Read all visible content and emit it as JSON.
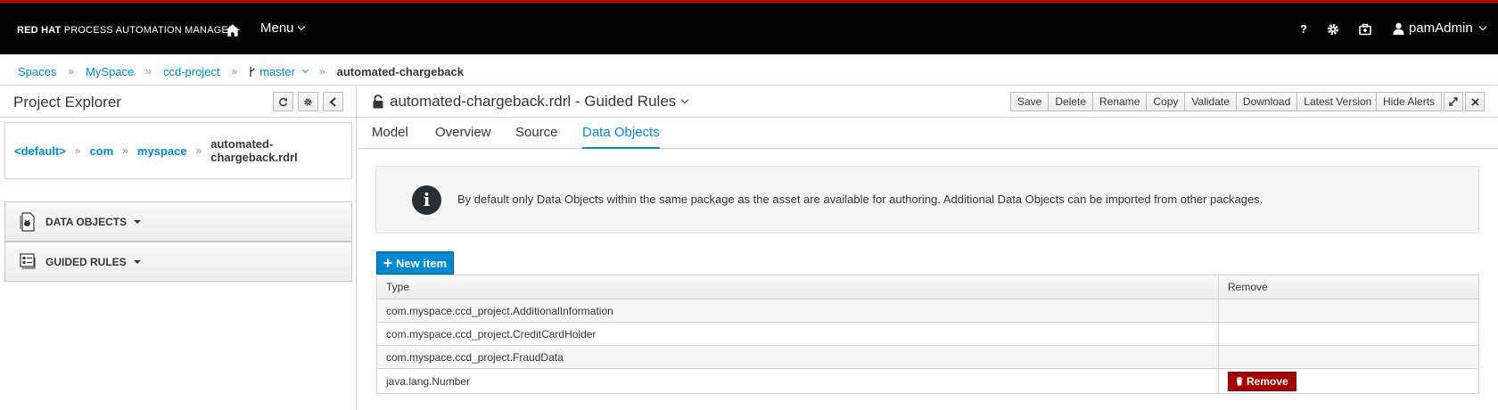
{
  "header": {
    "brand_bold": "RED HAT",
    "brand_rest": " PROCESS AUTOMATION MANAGER",
    "menu_label": "Menu",
    "help_label": "?",
    "user_name": "pamAdmin"
  },
  "breadcrumb": {
    "items": [
      "Spaces",
      "MySpace",
      "ccd-project"
    ],
    "branch": "master",
    "current": "automated-chargeback"
  },
  "project_explorer": {
    "title": "Project Explorer",
    "package_path": [
      "<default>",
      "com",
      "myspace"
    ],
    "file": "automated-chargeback.rdrl",
    "sections": [
      "DATA OBJECTS",
      "GUIDED RULES"
    ]
  },
  "editor": {
    "title": "automated-chargeback.rdrl - Guided Rules",
    "toolbar": [
      "Save",
      "Delete",
      "Rename",
      "Copy",
      "Validate",
      "Download"
    ],
    "version_label": "Latest Version",
    "hide_alerts": "Hide Alerts",
    "tabs": [
      "Model",
      "Overview",
      "Source",
      "Data Objects"
    ],
    "active_tab": "Data Objects",
    "info_text": "By default only Data Objects within the same package as the asset are available for authoring. Additional Data Objects can be imported from other packages.",
    "new_item_label": "New item",
    "table": {
      "headers": [
        "Type",
        "Remove"
      ],
      "rows": [
        "com.myspace.ccd_project.AdditionalInformation",
        "com.myspace.ccd_project.CreditCardHolder",
        "com.myspace.ccd_project.FraudData",
        "java.lang.Number"
      ],
      "remove_label": "Remove"
    }
  },
  "colors": {
    "accent": "#0088ce",
    "header_bg": "#030303",
    "header_top_stripe": "#cc0000",
    "danger": "#a30000"
  }
}
